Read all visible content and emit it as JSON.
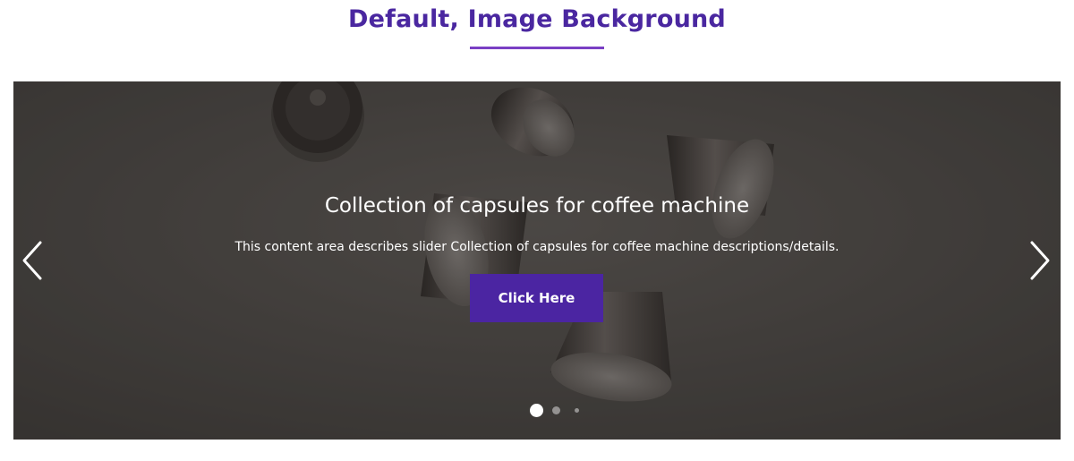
{
  "section": {
    "title": "Default, Image Background",
    "accent_color": "#4a27a0",
    "underline_color": "#7a3fc4"
  },
  "slider": {
    "slide": {
      "heading": "Collection of capsules for coffee machine",
      "description": "This content area describes slider Collection of capsules for coffee machine descriptions/details.",
      "button_label": "Click Here",
      "button_color": "#4b25a2"
    },
    "prev_icon": "chevron-left-icon",
    "next_icon": "chevron-right-icon",
    "dots_total": 3,
    "active_dot": 1
  }
}
